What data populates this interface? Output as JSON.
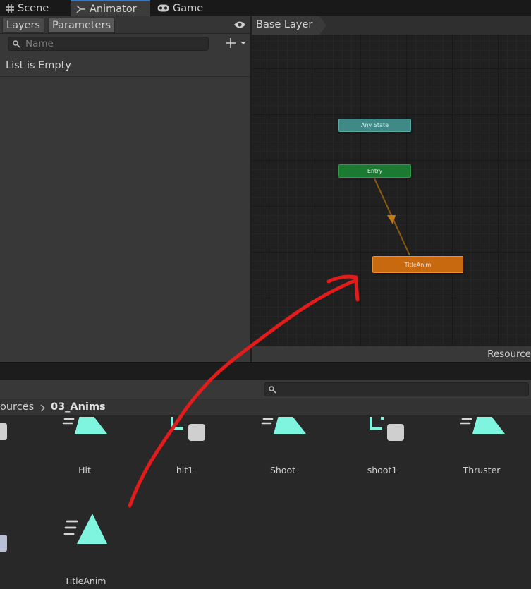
{
  "tabs": [
    {
      "label": "Scene",
      "icon": "grid-icon"
    },
    {
      "label": "Animator",
      "icon": "animator-icon"
    },
    {
      "label": "Game",
      "icon": "gamepad-icon"
    }
  ],
  "left_panel": {
    "tabs": [
      "Layers",
      "Parameters"
    ],
    "search_placeholder": "Name",
    "list_empty": "List is Empty"
  },
  "graph": {
    "breadcrumb": "Base Layer",
    "nodes": {
      "any_state": "Any State",
      "entry": "Entry",
      "title_anim": "TitleAnim"
    },
    "status_path": "Resource"
  },
  "project": {
    "path_parent": "ources",
    "path_current": "03_Anims",
    "assets": [
      "Hit",
      "hit1",
      "Shoot",
      "shoot1",
      "Thruster",
      "TitleAnim"
    ]
  },
  "colors": {
    "accent": "#3a79bb",
    "any_state": "#3f8a86",
    "entry": "#1a7a32",
    "default_state": "#c8690f",
    "anim_icon": "#7ff5e0",
    "annotation": "#e21b1b"
  }
}
